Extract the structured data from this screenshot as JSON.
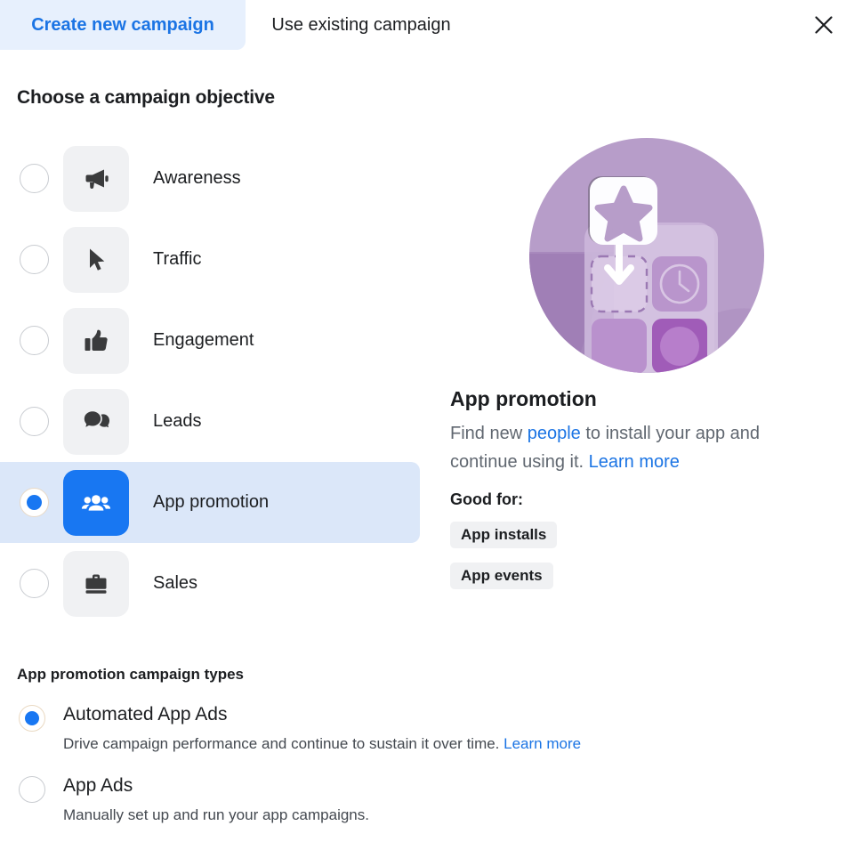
{
  "tabs": [
    {
      "label": "Create new campaign",
      "active": true,
      "name": "tab-create-new-campaign"
    },
    {
      "label": "Use existing campaign",
      "active": false,
      "name": "tab-use-existing-campaign"
    }
  ],
  "close_icon": "close-icon",
  "headings": {
    "objective": "Choose a campaign objective",
    "campaign_types": "App promotion campaign types"
  },
  "objectives": [
    {
      "label": "Awareness",
      "icon": "megaphone-icon",
      "selected": false
    },
    {
      "label": "Traffic",
      "icon": "cursor-icon",
      "selected": false
    },
    {
      "label": "Engagement",
      "icon": "thumbs-up-icon",
      "selected": false
    },
    {
      "label": "Leads",
      "icon": "chat-bubbles-icon",
      "selected": false
    },
    {
      "label": "App promotion",
      "icon": "people-icon",
      "selected": true
    },
    {
      "label": "Sales",
      "icon": "briefcase-icon",
      "selected": false
    }
  ],
  "detail": {
    "illustration": "app-promotion-illustration",
    "title": "App promotion",
    "desc_part1": "Find new ",
    "desc_link1": "people",
    "desc_part2": " to install your app and continue using it. ",
    "desc_link2": "Learn more",
    "good_for_label": "Good for:",
    "chips": [
      "App installs",
      "App events"
    ]
  },
  "campaign_types": [
    {
      "title": "Automated App Ads",
      "desc": "Drive campaign performance and continue to sustain it over time. ",
      "link": "Learn more",
      "selected": true
    },
    {
      "title": "App Ads",
      "desc": "Manually set up and run your app campaigns.",
      "link": "",
      "selected": false
    }
  ],
  "colors": {
    "accent_blue": "#1877f2",
    "link_blue": "#1b74e4",
    "tab_active_bg": "#e7f0fd",
    "row_selected_bg": "#dbe7f9",
    "tile_bg": "#f0f1f3",
    "illo_purple": "#b79dc9",
    "illo_purple_dark": "#9b73b0",
    "illo_tile_magenta": "#a05cb8"
  }
}
